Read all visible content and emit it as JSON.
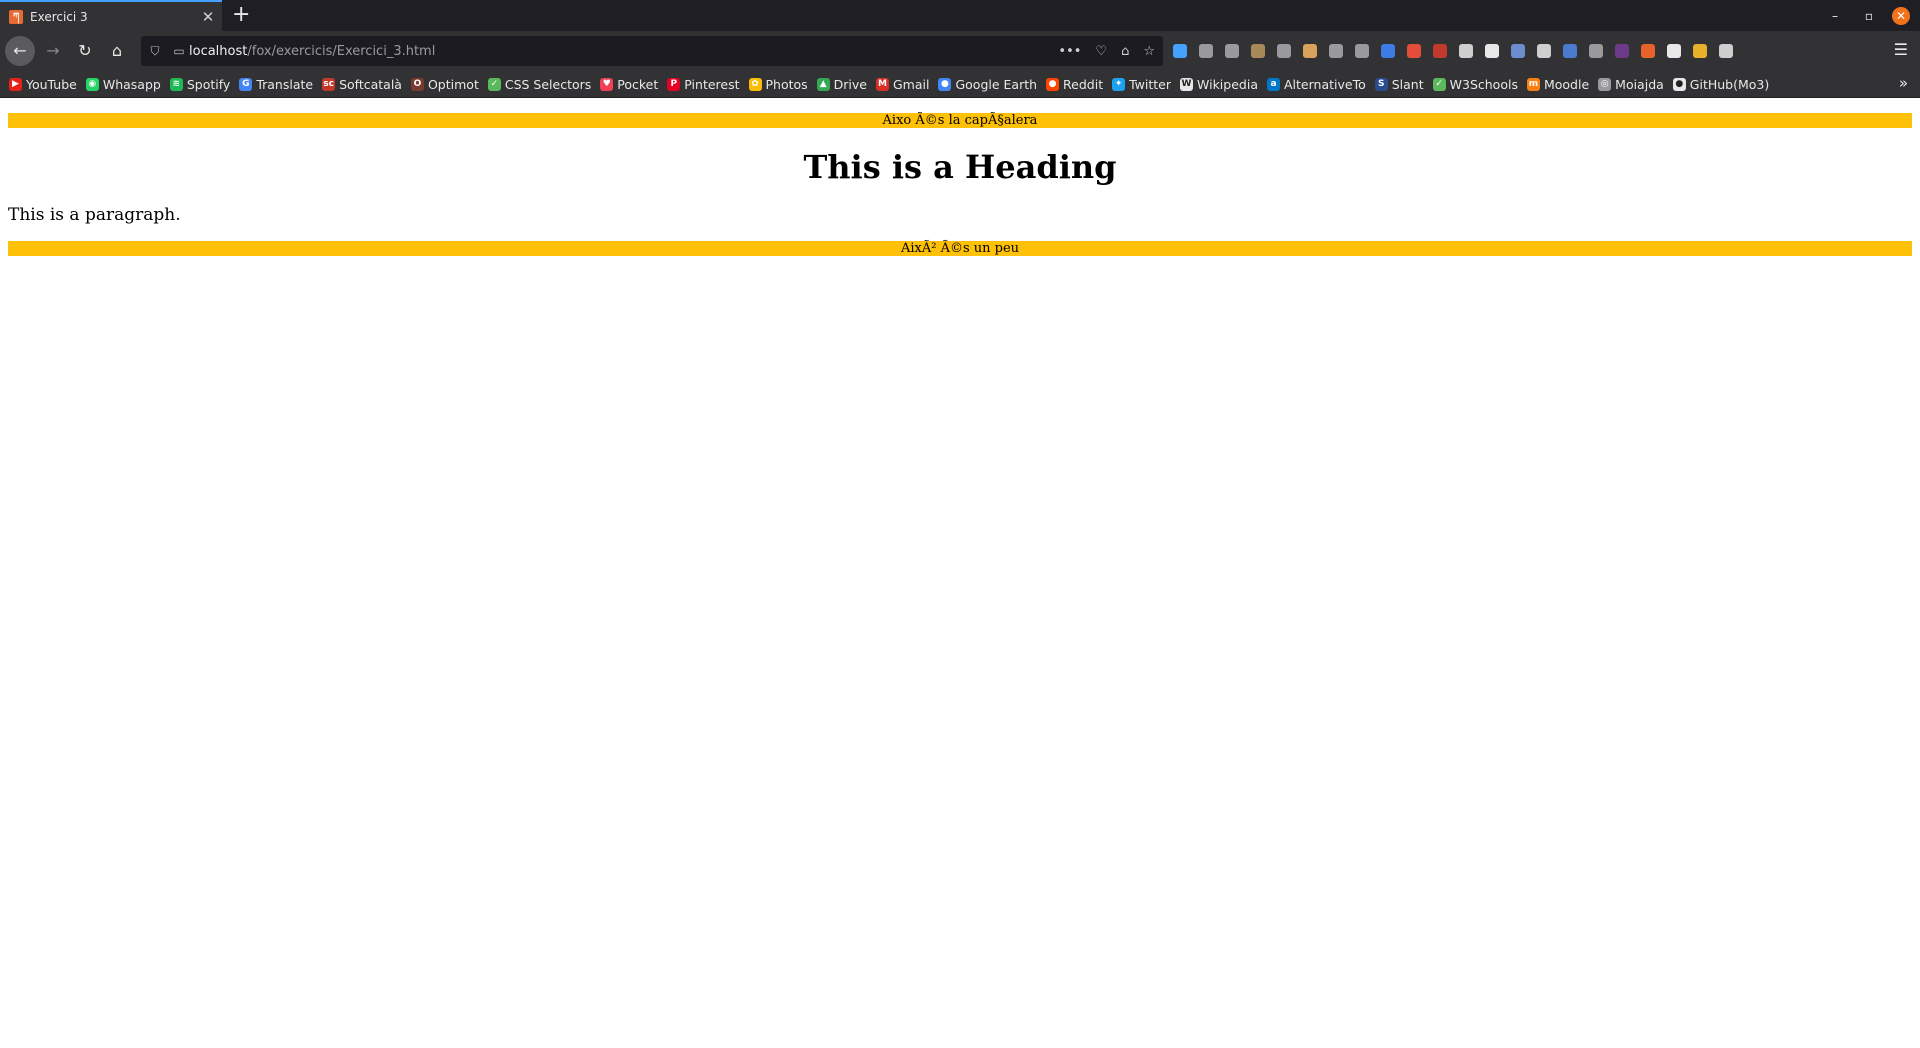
{
  "browser": {
    "tab": {
      "title": "Exercici 3",
      "favicon": "xampp-icon",
      "close_glyph": "✕"
    },
    "new_tab_glyph": "+",
    "window_controls": {
      "minimize": "–",
      "maximize": "▫",
      "close": "✕"
    },
    "nav": {
      "back": "←",
      "forward": "→",
      "reload": "↻",
      "home": "⌂"
    },
    "url": {
      "host": "localhost",
      "path": "/fox/exercicis/Exercici_3.html"
    },
    "url_actions": {
      "more": "•••",
      "pocket": "♡",
      "home": "⌂",
      "bookmark": "☆"
    },
    "toolbar_icon_colors": [
      "#45a1ff",
      "#9a9a9c",
      "#9a9a9c",
      "#a88a5a",
      "#9a9a9c",
      "#d9a25b",
      "#9a9a9c",
      "#9a9a9c",
      "#3d7be6",
      "#e44d3a",
      "#c0392b",
      "#cfcfcf",
      "#e8e8e8",
      "#6c8ecf",
      "#cfcfcf",
      "#4a7bd0",
      "#9a9a9c",
      "#6d3a8a",
      "#e8632c",
      "#e8e8e8",
      "#e8b12c",
      "#cfcfcf"
    ],
    "menu_glyph": "☰",
    "bookmarks": [
      {
        "label": "YouTube",
        "icon": "youtube-icon",
        "color": "#e62117",
        "glyph": "▶"
      },
      {
        "label": "Whasapp",
        "icon": "whatsapp-icon",
        "color": "#25d366",
        "glyph": "◉"
      },
      {
        "label": "Spotify",
        "icon": "spotify-icon",
        "color": "#1db954",
        "glyph": "≋"
      },
      {
        "label": "Translate",
        "icon": "translate-icon",
        "color": "#4285f4",
        "glyph": "G"
      },
      {
        "label": "Softcatalà",
        "icon": "softcatala-icon",
        "color": "#c0392b",
        "glyph": "sc"
      },
      {
        "label": "Optimot",
        "icon": "optimot-icon",
        "color": "#7a3b2e",
        "glyph": "O"
      },
      {
        "label": "CSS Selectors",
        "icon": "css-selectors-icon",
        "color": "#5cb85c",
        "glyph": "✓"
      },
      {
        "label": "Pocket",
        "icon": "pocket-icon",
        "color": "#ef4056",
        "glyph": "♥"
      },
      {
        "label": "Pinterest",
        "icon": "pinterest-icon",
        "color": "#e60023",
        "glyph": "P"
      },
      {
        "label": "Photos",
        "icon": "photos-icon",
        "color": "#fbbc05",
        "glyph": "✿"
      },
      {
        "label": "Drive",
        "icon": "drive-icon",
        "color": "#34a853",
        "glyph": "▲"
      },
      {
        "label": "Gmail",
        "icon": "gmail-icon",
        "color": "#d93025",
        "glyph": "M"
      },
      {
        "label": "Google Earth",
        "icon": "google-earth-icon",
        "color": "#4285f4",
        "glyph": "●"
      },
      {
        "label": "Reddit",
        "icon": "reddit-icon",
        "color": "#ff4500",
        "glyph": "●"
      },
      {
        "label": "Twitter",
        "icon": "twitter-icon",
        "color": "#1da1f2",
        "glyph": "✦"
      },
      {
        "label": "Wikipedia",
        "icon": "wikipedia-icon",
        "color": "#e8e8e8",
        "glyph": "W"
      },
      {
        "label": "AlternativeTo",
        "icon": "alternativeto-icon",
        "color": "#0077c8",
        "glyph": "a"
      },
      {
        "label": "Slant",
        "icon": "slant-icon",
        "color": "#2a4b8d",
        "glyph": "S"
      },
      {
        "label": "W3Schools",
        "icon": "w3schools-icon",
        "color": "#5cb85c",
        "glyph": "✓"
      },
      {
        "label": "Moodle",
        "icon": "moodle-icon",
        "color": "#f98012",
        "glyph": "m"
      },
      {
        "label": "Moiajda",
        "icon": "globe-icon",
        "color": "#9a9a9c",
        "glyph": "◎"
      },
      {
        "label": "GitHub(Mo3)",
        "icon": "github-icon",
        "color": "#e8e8e8",
        "glyph": "●"
      }
    ],
    "bookmarks_overflow": "»"
  },
  "page": {
    "header_text": "Aixo Ã©s la capÃ§alera",
    "heading": "This is a Heading",
    "paragraph": "This is a paragraph.",
    "footer_text": "AixÃ² Ã©s un peu",
    "band_color": "#ffc107"
  }
}
